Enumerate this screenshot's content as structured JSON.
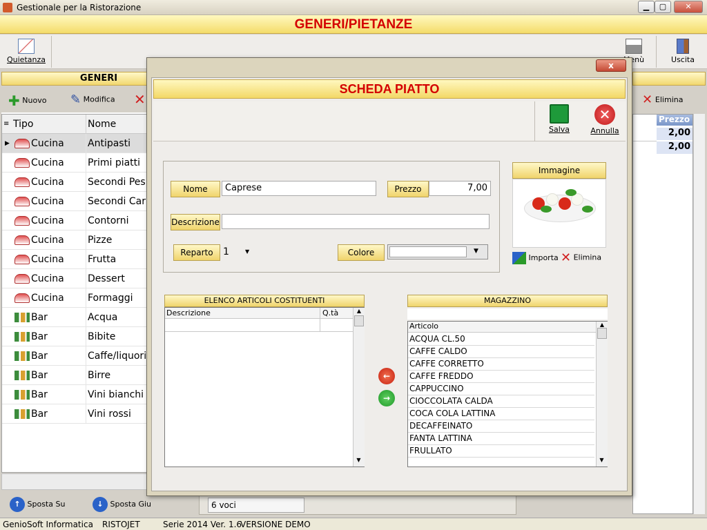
{
  "window": {
    "title": "Gestionale per la Ristorazione",
    "min": "▁",
    "max": "▢",
    "close": "✕"
  },
  "banner": {
    "title": "GENERI/PIETANZE"
  },
  "toolbar": {
    "quietanza": "Quietanza",
    "menu": "Menù",
    "uscita": "Uscita"
  },
  "generi": {
    "header": "GENERI",
    "buttons": {
      "nuovo": "Nuovo",
      "modifica": "Modifica"
    },
    "columns": {
      "tipo": "Tipo",
      "nome": "Nome"
    },
    "rows": [
      {
        "tipo": "Cucina",
        "nome": "Antipasti"
      },
      {
        "tipo": "Cucina",
        "nome": "Primi piatti"
      },
      {
        "tipo": "Cucina",
        "nome": "Secondi Pes"
      },
      {
        "tipo": "Cucina",
        "nome": "Secondi Carn"
      },
      {
        "tipo": "Cucina",
        "nome": "Contorni"
      },
      {
        "tipo": "Cucina",
        "nome": "Pizze"
      },
      {
        "tipo": "Cucina",
        "nome": "Frutta"
      },
      {
        "tipo": "Cucina",
        "nome": "Dessert"
      },
      {
        "tipo": "Cucina",
        "nome": "Formaggi"
      },
      {
        "tipo": "Bar",
        "nome": "Acqua"
      },
      {
        "tipo": "Bar",
        "nome": "Bibite"
      },
      {
        "tipo": "Bar",
        "nome": "Caffe/liquori"
      },
      {
        "tipo": "Bar",
        "nome": "Birre"
      },
      {
        "tipo": "Bar",
        "nome": "Vini bianchi"
      },
      {
        "tipo": "Bar",
        "nome": "Vini rossi"
      }
    ],
    "sposta_su": "Sposta Su",
    "sposta_giu": "Sposta Giu"
  },
  "pietanze": {
    "elimina": "Elimina",
    "prezzo_header": "Prezzo",
    "prezzi": [
      "2,00",
      "2,00"
    ],
    "count": "6 voci"
  },
  "statusbar": {
    "company": "GenioSoft Informatica",
    "product": "RISTOJET",
    "version": "Serie 2014 Ver. 1.6",
    "mode": "VERSIONE DEMO"
  },
  "dialog": {
    "close": "x",
    "title": "SCHEDA PIATTO",
    "salva": "Salva",
    "annulla": "Annulla",
    "nome_label": "Nome",
    "nome_value": "Caprese",
    "prezzo_label": "Prezzo",
    "prezzo_value": "7,00",
    "descrizione_label": "Descrizione",
    "descrizione_value": "",
    "reparto_label": "Reparto",
    "reparto_value": "1",
    "colore_label": "Colore",
    "colore_value": "",
    "immagine_label": "Immagine",
    "importa": "Importa",
    "elimina": "Elimina",
    "articoli": {
      "header": "ELENCO ARTICOLI COSTITUENTI",
      "col_descrizione": "Descrizione",
      "col_qta": "Q.tà"
    },
    "magazzino": {
      "header": "MAGAZZINO",
      "col_articolo": "Articolo",
      "items": [
        "ACQUA CL.50",
        "CAFFE CALDO",
        "CAFFE CORRETTO",
        "CAFFE FREDDO",
        "CAPPUCCINO",
        "CIOCCOLATA CALDA",
        "COCA COLA LATTINA",
        "DECAFFEINATO",
        "FANTA LATTINA",
        "FRULLATO"
      ]
    }
  },
  "colors": {
    "banner_text": "#d40000",
    "header_gold": "#f2d870",
    "dialog_bg": "#dcd5bd"
  }
}
